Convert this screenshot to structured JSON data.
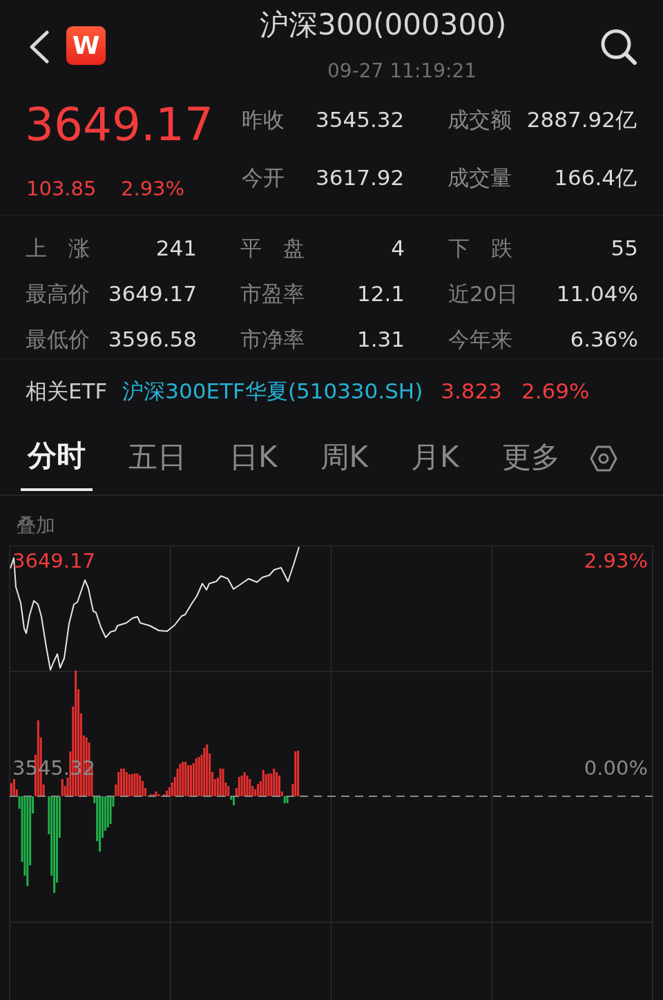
{
  "header": {
    "title": "沪深300(000300)",
    "time": "09-27 11:19:21",
    "logo": "W"
  },
  "quote": {
    "price": "3649.17",
    "change": "103.85",
    "change_pct": "2.93%",
    "fields": [
      {
        "label": "昨收",
        "value": "3545.32"
      },
      {
        "label": "成交额",
        "value": "2887.92亿"
      },
      {
        "label": "今开",
        "value": "3617.92"
      },
      {
        "label": "成交量",
        "value": "166.4亿"
      }
    ]
  },
  "stats": [
    {
      "label": "上　涨",
      "value": "241"
    },
    {
      "label": "平　盘",
      "value": "4"
    },
    {
      "label": "下　跌",
      "value": "55"
    },
    {
      "label": "最高价",
      "value": "3649.17"
    },
    {
      "label": "市盈率",
      "value": "12.1"
    },
    {
      "label": "近20日",
      "value": "11.04%"
    },
    {
      "label": "最低价",
      "value": "3596.58"
    },
    {
      "label": "市净率",
      "value": "1.31"
    },
    {
      "label": "今年来",
      "value": "6.36%"
    }
  ],
  "etf": {
    "label": "相关ETF",
    "name": "沪深300ETF华夏(510330.SH)",
    "price": "3.823",
    "change_pct": "2.69%"
  },
  "tabs": [
    {
      "label": "分时",
      "selected": true
    },
    {
      "label": "五日",
      "selected": false
    },
    {
      "label": "日K",
      "selected": false
    },
    {
      "label": "周K",
      "selected": false
    },
    {
      "label": "月K",
      "selected": false
    },
    {
      "label": "更多",
      "selected": false
    }
  ],
  "overlay_label": "叠加",
  "chart": {
    "left_labels": [
      {
        "text": "3649.17",
        "kind": "up"
      },
      {
        "text": "3545.32",
        "kind": "flat"
      }
    ],
    "right_labels": [
      {
        "text": "2.93%",
        "kind": "up"
      },
      {
        "text": "0.00%",
        "kind": "flat"
      }
    ]
  }
}
